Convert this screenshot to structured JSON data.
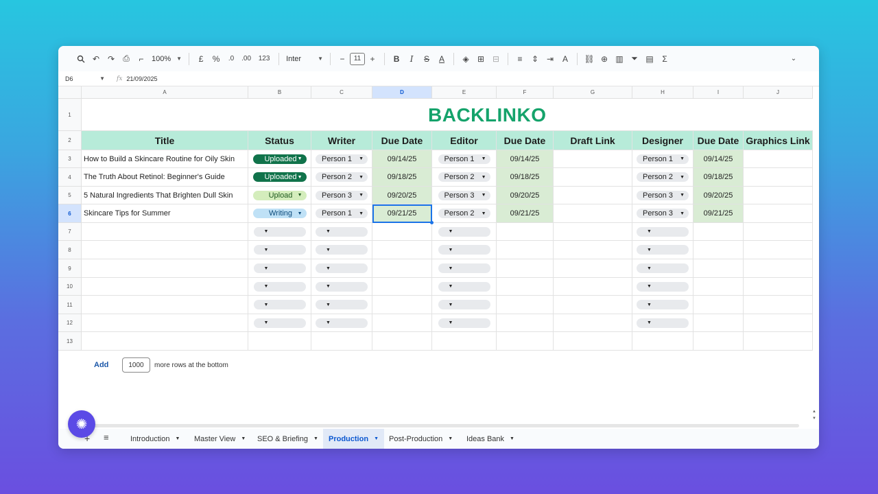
{
  "toolbar": {
    "zoom": "100%",
    "currency": "£",
    "percent": "%",
    "dec_dec": ".0",
    "dec_inc": ".00",
    "number_format": "123",
    "font": "Inter",
    "font_size": "11",
    "minus": "−",
    "plus": "+",
    "bold": "B",
    "italic": "I",
    "strike": "S",
    "textcolor": "A",
    "sum": "Σ"
  },
  "formula_bar": {
    "cell_ref": "D6",
    "fx": "fx",
    "value": "21/09/2025"
  },
  "columns": [
    "A",
    "B",
    "C",
    "D",
    "E",
    "F",
    "G",
    "H",
    "I",
    "J"
  ],
  "rows": [
    "1",
    "2",
    "3",
    "4",
    "5",
    "6",
    "7",
    "8",
    "9",
    "10",
    "11",
    "12",
    "13"
  ],
  "logo": "BACKLINKO",
  "headers": [
    "Title",
    "Status",
    "Writer",
    "Due Date",
    "Editor",
    "Due Date",
    "Draft Link",
    "Designer",
    "Due Date",
    "Graphics Link"
  ],
  "data_rows": [
    {
      "title": "How to Build a Skincare Routine for Oily Skin",
      "status": "Uploaded",
      "writer": "Person 1",
      "writer_due": "09/14/25",
      "editor": "Person 1",
      "editor_due": "09/14/25",
      "designer": "Person 1",
      "designer_due": "09/14/25"
    },
    {
      "title": "The Truth About Retinol: Beginner's Guide",
      "status": "Uploaded",
      "writer": "Person 2",
      "writer_due": "09/18/25",
      "editor": "Person 2",
      "editor_due": "09/18/25",
      "designer": "Person 2",
      "designer_due": "09/18/25"
    },
    {
      "title": "5 Natural Ingredients That Brighten Dull Skin",
      "status": "Upload",
      "writer": "Person 3",
      "writer_due": "09/20/25",
      "editor": "Person 3",
      "editor_due": "09/20/25",
      "designer": "Person 3",
      "designer_due": "09/20/25"
    },
    {
      "title": "Skincare Tips for Summer",
      "status": "Writing",
      "writer": "Person 1",
      "writer_due": "09/21/25",
      "editor": "Person 2",
      "editor_due": "09/21/25",
      "designer": "Person 3",
      "designer_due": "09/21/25"
    }
  ],
  "status_colors": {
    "Uploaded": "#11734b",
    "Upload": "#d4edbc",
    "Writing": "#bfe1f6"
  },
  "add_rows": {
    "button": "Add",
    "count": "1000",
    "suffix": "more rows at the bottom"
  },
  "sheet_tabs": [
    "Introduction",
    "Master View",
    "SEO & Briefing",
    "Production",
    "Post-Production",
    "Ideas Bank"
  ],
  "active_tab": "Production",
  "icons": {
    "add_sheet": "+",
    "all_sheets": "≡",
    "fab": "✺",
    "arrow": "▼"
  }
}
